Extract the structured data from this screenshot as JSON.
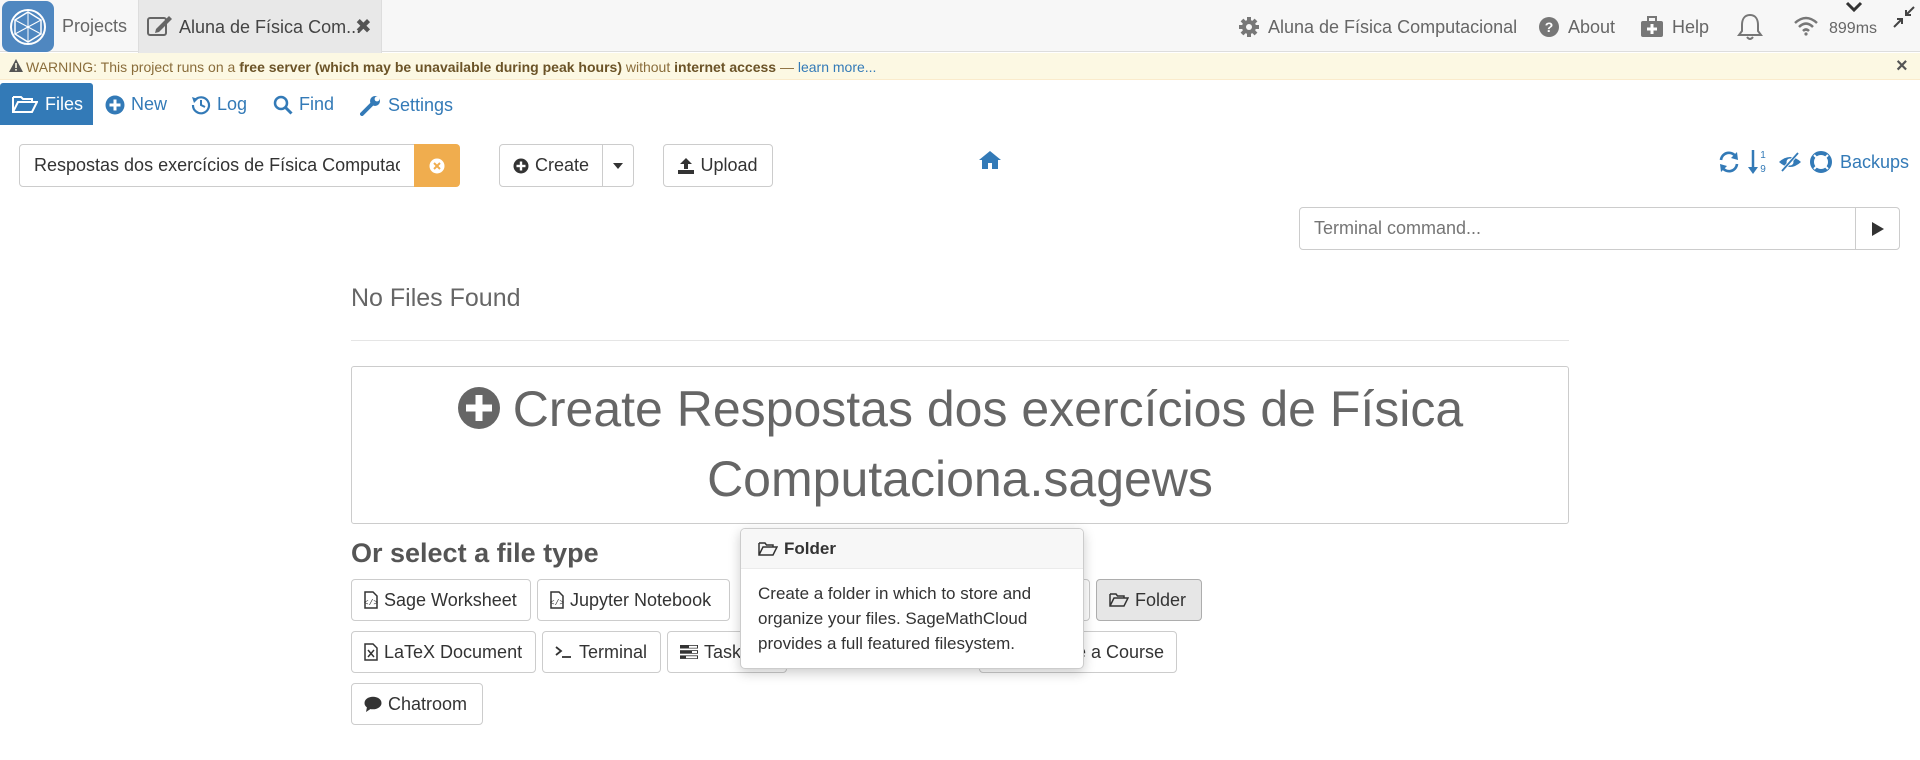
{
  "topbar": {
    "projects_label": "Projects",
    "tab_label": "Aluna de Física Com...",
    "tab_close": "✖",
    "project_name": "Aluna de Física Computacional",
    "about_label": "About",
    "help_label": "Help",
    "ping": "899ms"
  },
  "warning": {
    "prefix": "WARNING: This project runs on a ",
    "bold1": "free server (which may be unavailable during peak hours)",
    "middle": " without ",
    "bold2": "internet access",
    "dash": " — ",
    "link": "learn more...",
    "close": "×"
  },
  "file_nav": {
    "files": "Files",
    "new": "New",
    "log": "Log",
    "find": "Find",
    "settings": "Settings"
  },
  "toolbar": {
    "search_value": "Respostas dos exercícios de Física Computacional",
    "create_label": "Create",
    "upload_label": "Upload",
    "backups_label": "Backups",
    "terminal_placeholder": "Terminal command..."
  },
  "main": {
    "no_files": "No Files Found",
    "create_big_line1": "Create Respostas dos exercícios de Física",
    "create_big_line2": "Computaciona.sagews",
    "select_title": "Or select a file type",
    "file_types": {
      "sage": "Sage Worksheet",
      "jupyter": "Jupyter Notebook",
      "folder": "Folder",
      "latex": "LaTeX Document",
      "terminal": "Terminal",
      "task": "Task",
      "course": "e a Course",
      "chat": "Chatroom"
    }
  },
  "popover": {
    "title": "Folder",
    "body": "Create a folder in which to store and organize your files. SageMathCloud provides a full featured filesystem."
  },
  "colors": {
    "accent": "#337ab7",
    "warning_bg": "#fcf8e3",
    "clear_button": "#f0ad4e"
  }
}
